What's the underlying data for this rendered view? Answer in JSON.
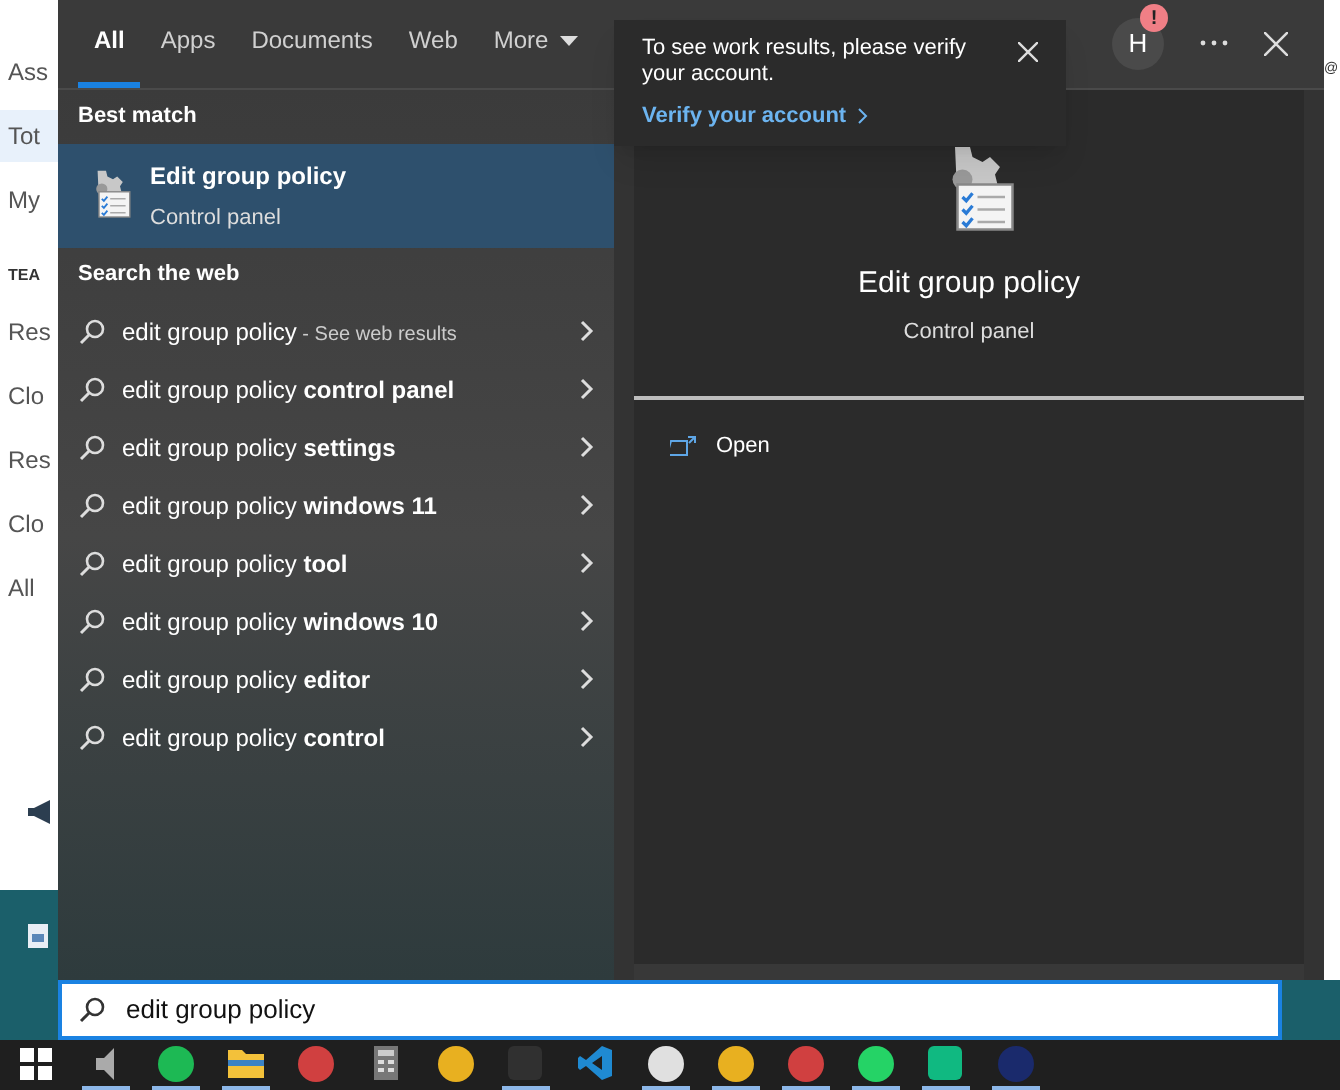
{
  "background_page": {
    "sidebar_fragments": [
      {
        "text": "Ass",
        "selected": false
      },
      {
        "text": "Tot",
        "selected": true
      },
      {
        "text": "My",
        "selected": false
      },
      {
        "text": "TEA",
        "selected": false
      },
      {
        "text": "Res",
        "selected": false
      },
      {
        "text": "Clo",
        "selected": false
      },
      {
        "text": "Res",
        "selected": false
      },
      {
        "text": "Clo",
        "selected": false
      },
      {
        "text": "All",
        "selected": false
      }
    ],
    "right_fragment": "@"
  },
  "tabs": [
    {
      "label": "All",
      "selected": true
    },
    {
      "label": "Apps",
      "selected": false
    },
    {
      "label": "Documents",
      "selected": false
    },
    {
      "label": "Web",
      "selected": false
    },
    {
      "label": "More",
      "selected": false
    }
  ],
  "account_badge": {
    "initial": "H",
    "alert": "!"
  },
  "notice": {
    "text": "To see work results, please verify your account.",
    "link": "Verify your account"
  },
  "best_match": {
    "heading": "Best match",
    "title": "Edit group policy",
    "subtitle": "Control panel",
    "selected": true
  },
  "web_heading": "Search the web",
  "suggestions": [
    {
      "text": "edit group policy",
      "hint": "- See web results"
    },
    {
      "text": "edit group policy **control panel**"
    },
    {
      "text": "edit group policy **settings**"
    },
    {
      "text": "edit group policy **windows 11**"
    },
    {
      "text": "edit group policy **tool**"
    },
    {
      "text": "edit group policy **windows 10**"
    },
    {
      "text": "edit group policy **editor**"
    },
    {
      "text": "edit group policy **control**"
    }
  ],
  "preview": {
    "title": "Edit group policy",
    "subtitle": "Control panel",
    "actions": [
      "Open"
    ]
  },
  "search": {
    "value": "edit group policy"
  },
  "taskbar": [
    {
      "kind": "windows",
      "running": false
    },
    {
      "kind": "speaker",
      "running": true
    },
    {
      "kind": "circle",
      "color": "#1db954",
      "running": true
    },
    {
      "kind": "folder",
      "running": true
    },
    {
      "kind": "circle",
      "color": "#d04040",
      "running": false
    },
    {
      "kind": "calculator",
      "running": false
    },
    {
      "kind": "circle",
      "color": "#e8b020",
      "running": false
    },
    {
      "kind": "square",
      "color": "#303030",
      "running": true
    },
    {
      "kind": "code",
      "running": false
    },
    {
      "kind": "circle",
      "color": "#e0e0e0",
      "running": true
    },
    {
      "kind": "circle",
      "color": "#e8b020",
      "running": true
    },
    {
      "kind": "circle",
      "color": "#d04040",
      "running": true
    },
    {
      "kind": "circle",
      "color": "#25d366",
      "running": true
    },
    {
      "kind": "square",
      "color": "#10b981",
      "running": true
    },
    {
      "kind": "circle",
      "color": "#1a2a6c",
      "running": true
    }
  ]
}
